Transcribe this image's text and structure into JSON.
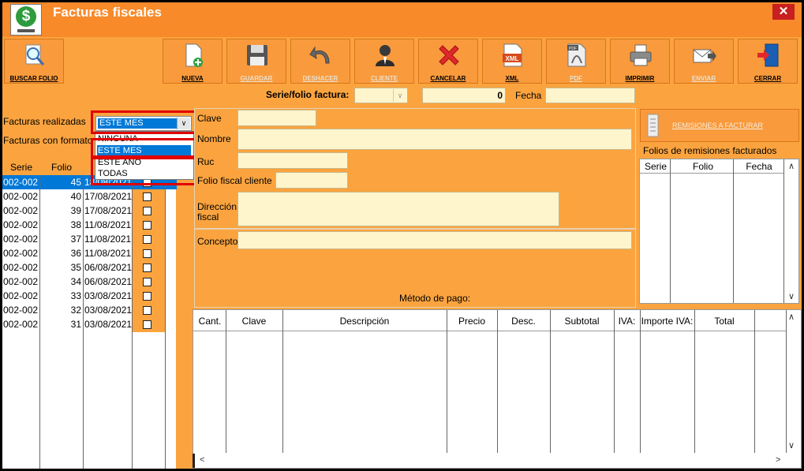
{
  "window": {
    "title": "Facturas fiscales",
    "close_symbol": "✕"
  },
  "toolbar": {
    "buscar": "BUSCAR FOLIO",
    "nueva": "NUEVA",
    "guardar": "GUARDAR",
    "deshacer": "DESHACER",
    "cliente": "CLIENTE",
    "cancelar": "CANCELAR",
    "xml": "XML",
    "pdf": "PDF",
    "imprimir": "IMPRIMIR",
    "enviar": "ENVIAR",
    "cerrar": "CERRAR",
    "xml_icon_text": "XML",
    "pdf_icon_text": "PDF"
  },
  "serie_folio": {
    "label": "Serie/folio factura:",
    "folio_value": "0",
    "fecha_label": "Fecha"
  },
  "filters": {
    "realizadas_label": "Facturas realizadas",
    "formato_label": "Facturas con formato",
    "selected": "ESTE MES",
    "options": [
      "NINGUNA",
      "ESTE MES",
      "ESTE AÑO",
      "TODAS"
    ]
  },
  "invoice_list": {
    "columns": [
      "Serie",
      "Folio"
    ],
    "rows": [
      {
        "serie": "002-002",
        "folio": "45",
        "fecha": "18/08/2021"
      },
      {
        "serie": "002-002",
        "folio": "40",
        "fecha": "17/08/2021"
      },
      {
        "serie": "002-002",
        "folio": "39",
        "fecha": "17/08/2021"
      },
      {
        "serie": "002-002",
        "folio": "38",
        "fecha": "11/08/2021"
      },
      {
        "serie": "002-002",
        "folio": "37",
        "fecha": "11/08/2021"
      },
      {
        "serie": "002-002",
        "folio": "36",
        "fecha": "11/08/2021"
      },
      {
        "serie": "002-002",
        "folio": "35",
        "fecha": "06/08/2021"
      },
      {
        "serie": "002-002",
        "folio": "34",
        "fecha": "06/08/2021"
      },
      {
        "serie": "002-002",
        "folio": "33",
        "fecha": "03/08/2021"
      },
      {
        "serie": "002-002",
        "folio": "32",
        "fecha": "03/08/2021"
      },
      {
        "serie": "002-002",
        "folio": "31",
        "fecha": "03/08/2021"
      }
    ]
  },
  "client_form": {
    "clave": "Clave",
    "nombre": "Nombre",
    "ruc": "Ruc",
    "folio_fiscal": "Folio fiscal cliente",
    "direccion_1": "Dirección",
    "direccion_2": "fiscal",
    "concepto": "Concepto",
    "metodo_pago": "Método de pago:"
  },
  "remisiones": {
    "button": "REMISIONES A FACTURAR",
    "title": "Folios de remisiones facturados",
    "columns": [
      "Serie",
      "Folio",
      "Fecha"
    ]
  },
  "detail_table": {
    "columns": [
      "Cant.",
      "Clave",
      "Descripción",
      "Precio",
      "Desc.",
      "Subtotal",
      "IVA:",
      "Importe IVA:",
      "Total"
    ]
  },
  "colors": {
    "window_bg": "#fba43f",
    "titlebar": "#f88a2a",
    "selection": "#0078d7",
    "input_bg": "#fff5cc",
    "highlight_border": "#e00000"
  }
}
